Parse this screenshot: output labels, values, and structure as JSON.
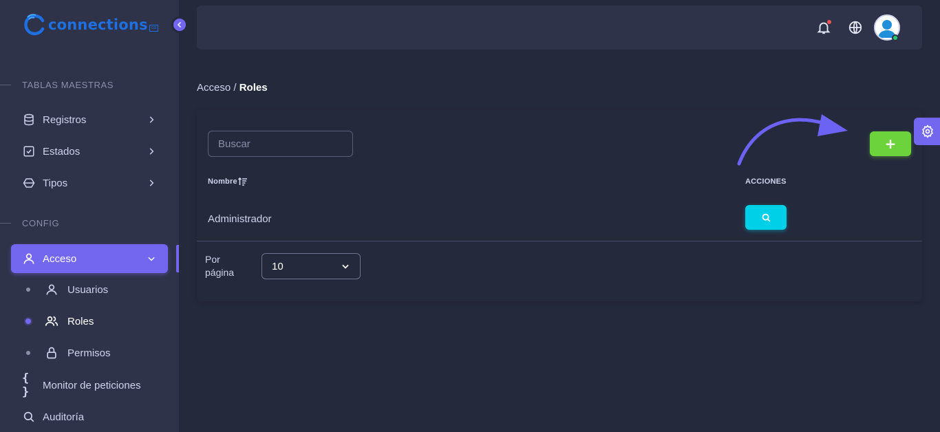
{
  "brand": {
    "name": "connections",
    "suffix": "co"
  },
  "sidebar": {
    "sections": [
      {
        "title": "TABLAS MAESTRAS"
      },
      {
        "title": "CONFIG"
      }
    ],
    "items": [
      {
        "label": "Registros",
        "icon": "database-icon"
      },
      {
        "label": "Estados",
        "icon": "checkbox-icon"
      },
      {
        "label": "Tipos",
        "icon": "hexagon-icon"
      },
      {
        "label": "Acceso",
        "icon": "user-icon",
        "active": true
      },
      {
        "label": "Monitor de peticiones",
        "icon": "braces-icon"
      },
      {
        "label": "Auditoría",
        "icon": "search-icon"
      }
    ],
    "sub_items": [
      {
        "label": "Usuarios",
        "icon": "user-icon"
      },
      {
        "label": "Roles",
        "icon": "users-icon",
        "active": true
      },
      {
        "label": "Permisos",
        "icon": "lock-icon"
      }
    ]
  },
  "breadcrumb": {
    "parent": "Acceso /",
    "current": "Roles"
  },
  "search": {
    "placeholder": "Buscar",
    "value": ""
  },
  "table": {
    "columns": [
      "Nombre",
      "ACCIONES"
    ],
    "rows": [
      {
        "nombre": "Administrador"
      }
    ]
  },
  "add_button": {
    "label": "+"
  },
  "pagination": {
    "label": "Por página",
    "per_page": "10"
  },
  "colors": {
    "primary": "#7367f0",
    "success": "#6dd33d",
    "info": "#00cfe8",
    "danger": "#ea5455",
    "online": "#28c76f"
  }
}
